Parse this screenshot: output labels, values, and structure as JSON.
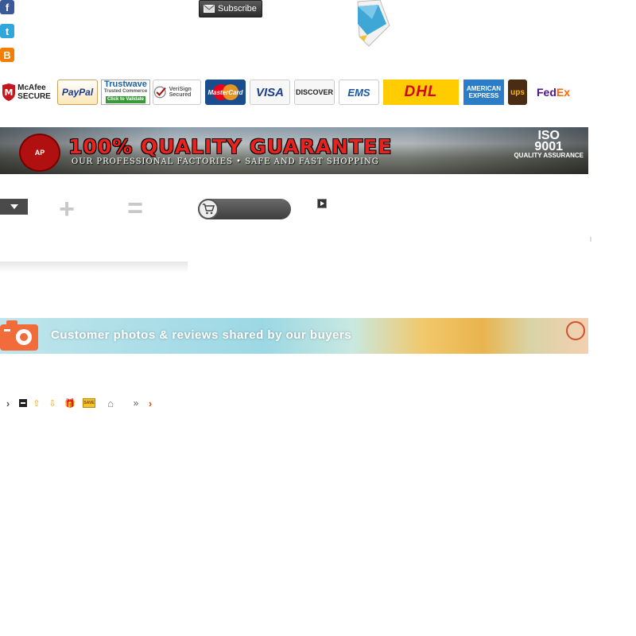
{
  "social": {
    "facebook_icon": "f",
    "twitter_icon": "t",
    "blogger_icon": "B"
  },
  "subscribe": {
    "label": "Subscribe"
  },
  "payment_logos": {
    "mcafee_1": "McAfee",
    "mcafee_2": "SECURE",
    "paypal": "PayPal",
    "trustwave_1": "Trustwave",
    "trustwave_2": "Trusted Commerce",
    "trustwave_3": "Click to Validate",
    "verisign": "VeriSign Secured",
    "mastercard": "MasterCard",
    "visa": "VISA",
    "discover": "DISCOVER",
    "ems": "EMS",
    "dhl": "DHL",
    "amex_1": "AMERICAN",
    "amex_2": "EXPRESS",
    "ups": "ups",
    "fedex_1": "Fed",
    "fedex_2": "Ex"
  },
  "quality_banner": {
    "badge": "AP",
    "title": "100% QUALITY GUARANTEE",
    "subtitle": "OUR PROFESSIONAL FACTORIES  •  SAFE AND FAST SHOPPING",
    "iso_1": "ISO",
    "iso_2": "9001",
    "iso_3": "QUALITY ASSURANCE"
  },
  "combo": {
    "plus": "+",
    "equals": "=",
    "cart_icon": "🛒"
  },
  "photo_banner": {
    "text": "Customer photos & reviews shared by our buyers"
  },
  "toolbar": {
    "chevron": "›",
    "up": "⇧",
    "down": "⇩",
    "gift": "🎁",
    "save": "SAVE",
    "home": "⌂",
    "double_chevron": "»",
    "orange_chevron": "›"
  },
  "colors": {
    "quality_title": "#e8231f",
    "dhl_bg": "#ffcc00",
    "facebook": "#3b5998",
    "twitter": "#2fa6dc",
    "blogger": "#f57d00"
  }
}
